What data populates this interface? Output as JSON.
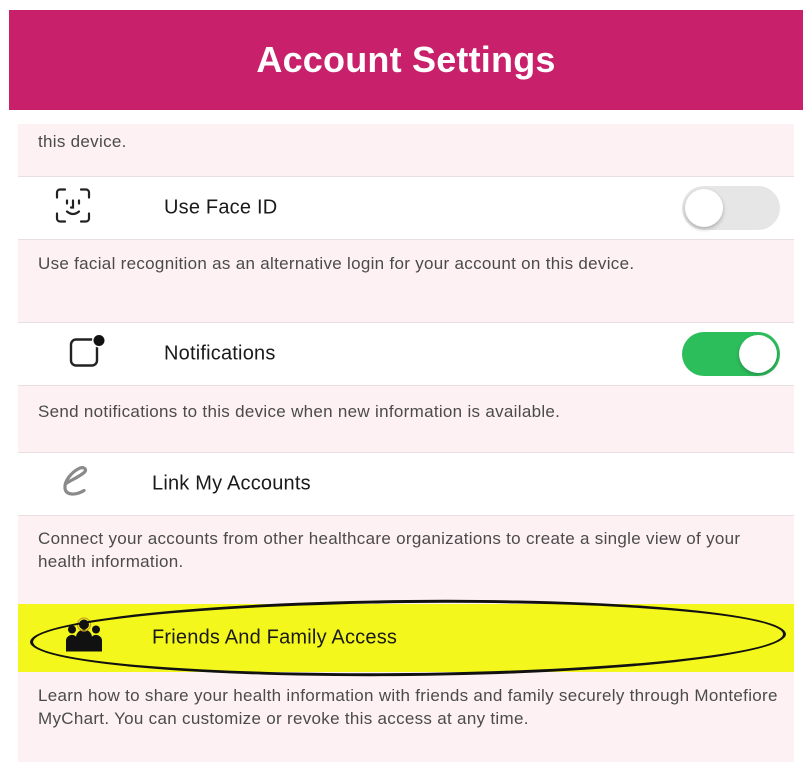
{
  "header": {
    "title": "Account Settings",
    "background_color": "#c8206a"
  },
  "settings": {
    "top_description": "this device.",
    "face_id": {
      "label": "Use Face ID",
      "icon": "face-id-icon",
      "enabled": false,
      "description": "Use facial recognition as an alternative login for your account on this device."
    },
    "notifications": {
      "label": "Notifications",
      "icon": "notification-badge-icon",
      "enabled": true,
      "toggle_color": "#2dbe5c",
      "description": "Send notifications to this device when new information is available."
    },
    "link_accounts": {
      "label": "Link My Accounts",
      "icon": "link-accounts-e-icon",
      "description": "Connect your accounts from other healthcare organizations to create a single view of your health information."
    },
    "friends_family": {
      "label": "Friends And Family Access",
      "icon": "family-icon",
      "highlight_color": "#f3f71b",
      "description": "Learn how to share your health information with friends and family securely through Montefiore MyChart. You can customize or revoke this access at any time."
    }
  }
}
